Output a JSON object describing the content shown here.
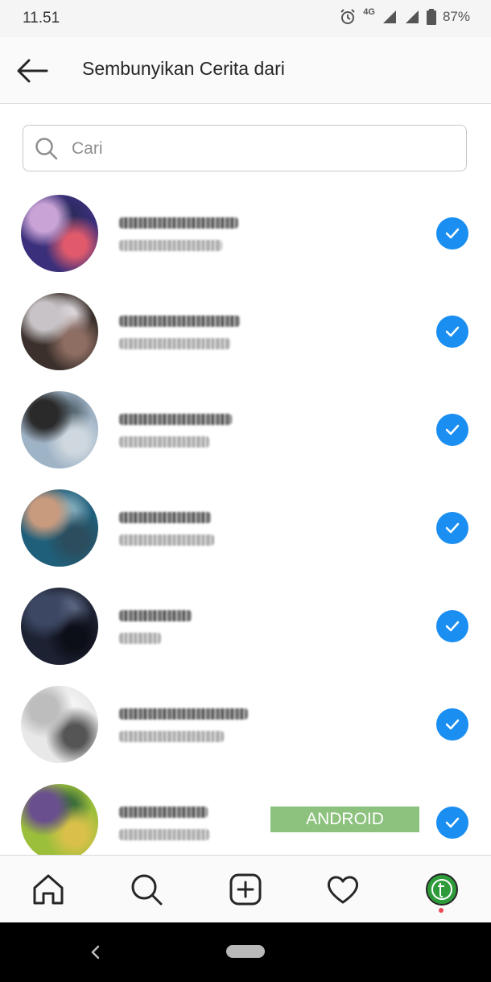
{
  "status_bar": {
    "time": "11.51",
    "network": "4G",
    "battery": "87%"
  },
  "header": {
    "title": "Sembunyikan Cerita dari",
    "back_icon": "arrow-left-icon"
  },
  "search": {
    "placeholder": "Cari",
    "value": ""
  },
  "accounts": [
    {
      "checked": true,
      "avatar_colors": [
        "#3a2f7a",
        "#c9a3d6",
        "#e05a6c",
        "#2b2b5e"
      ]
    },
    {
      "checked": true,
      "avatar_colors": [
        "#3b302c",
        "#c8c3c6",
        "#8e6d62",
        "#d9d4d8"
      ]
    },
    {
      "checked": true,
      "avatar_colors": [
        "#9fb3c6",
        "#2a2a2a",
        "#cfd8df",
        "#5a6a75"
      ]
    },
    {
      "checked": true,
      "avatar_colors": [
        "#1f5f7a",
        "#c89a7e",
        "#2b4d5e",
        "#7fa8b8"
      ]
    },
    {
      "checked": true,
      "avatar_colors": [
        "#1d2233",
        "#3c4763",
        "#0d0f18",
        "#59647f"
      ]
    },
    {
      "checked": true,
      "avatar_colors": [
        "#e8e8e8",
        "#bdbdbd",
        "#555555",
        "#f4f4f4"
      ]
    },
    {
      "checked": true,
      "avatar_colors": [
        "#9bbf3a",
        "#6a4f8e",
        "#d8c04a",
        "#3d6e3a"
      ]
    }
  ],
  "watermark": "ANDROID HEBAT.COM",
  "bottom_nav": [
    "home-icon",
    "search-icon",
    "new-post-icon",
    "activity-heart-icon",
    "profile-avatar"
  ],
  "colors": {
    "check_blue": "#1a8ef1",
    "notification_dot": "#ed4956"
  }
}
